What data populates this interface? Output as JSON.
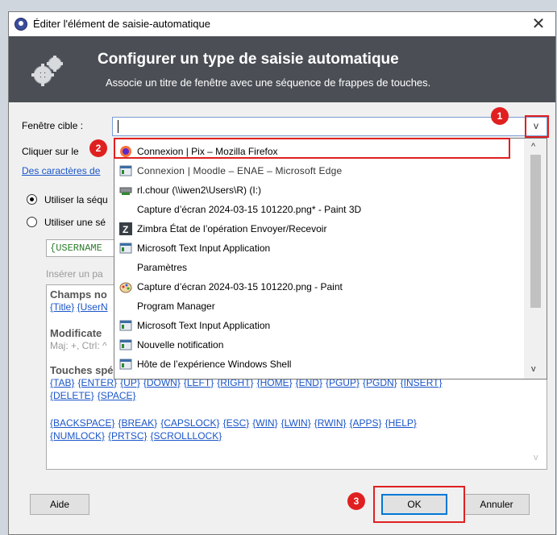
{
  "window": {
    "title": "Éditer l'élément de saisie-automatique",
    "close_symbol": "✕"
  },
  "header": {
    "title": "Configurer un type de saisie automatique",
    "subtitle": "Associe un titre de fenêtre avec une séquence de frappes de touches."
  },
  "form": {
    "target_label": "Fenêtre cible :",
    "click_label": "Cliquer sur le",
    "characters_link": "Des caractères de",
    "radio_default": "Utiliser la séqu",
    "radio_custom": "Utiliser une sé",
    "sequence_value": "{USERNAME",
    "insert_hint": "Insérer un pa"
  },
  "help": {
    "fields_title": "Champs no",
    "fields_links": [
      "{Title}",
      "{UserN"
    ],
    "modifiers_title": "Modificate",
    "modifiers_text": "Maj: +, Ctrl: ^",
    "special_title": "Touches spéciales :",
    "special_line1": [
      "{TAB}",
      "{ENTER}",
      "{UP}",
      "{DOWN}",
      "{LEFT}",
      "{RIGHT}",
      "{HOME}",
      "{END}",
      "{PGUP}",
      "{PGDN}",
      "{INSERT}"
    ],
    "special_line2": [
      "{DELETE}",
      "{SPACE}"
    ],
    "special_line3": [
      "{BACKSPACE}",
      "{BREAK}",
      "{CAPSLOCK}",
      "{ESC}",
      "{WIN}",
      "{LWIN}",
      "{RWIN}",
      "{APPS}",
      "{HELP}"
    ],
    "special_line4": [
      "{NUMLOCK}",
      "{PRTSC}",
      "{SCROLLLOCK}"
    ]
  },
  "dropdown": {
    "items": [
      {
        "label": "Connexion | Pix – Mozilla Firefox",
        "icon": "firefox-icon"
      },
      {
        "label": "Connexion | Moodle – ENAE – Microsoft Edge",
        "icon": "window-icon"
      },
      {
        "label": "rl.chour (\\\\iwen2\\Users\\R) (I:)",
        "icon": "drive-icon"
      },
      {
        "label": "Capture d’écran 2024-03-15 101220.png* - Paint 3D",
        "icon": "blank-icon"
      },
      {
        "label": "Zimbra État de l’opération Envoyer/Recevoir",
        "icon": "zimbra-icon"
      },
      {
        "label": "Microsoft Text Input Application",
        "icon": "window-icon"
      },
      {
        "label": "Paramètres",
        "icon": "blank-icon"
      },
      {
        "label": "Capture d’écran 2024-03-15 101220.png - Paint",
        "icon": "paint-icon"
      },
      {
        "label": "Program Manager",
        "icon": "blank-icon"
      },
      {
        "label": "Microsoft Text Input Application",
        "icon": "window-icon"
      },
      {
        "label": "Nouvelle notification",
        "icon": "window-icon"
      },
      {
        "label": "Hôte de l’expérience Windows Shell",
        "icon": "window-icon"
      }
    ],
    "scroll_up": "^",
    "scroll_down": "v",
    "combo_arrow": "v"
  },
  "buttons": {
    "help": "Aide",
    "ok": "OK",
    "cancel": "Annuler"
  },
  "annotations": {
    "badge1": "1",
    "badge2": "2",
    "badge3": "3",
    "accent": "#e02020"
  }
}
